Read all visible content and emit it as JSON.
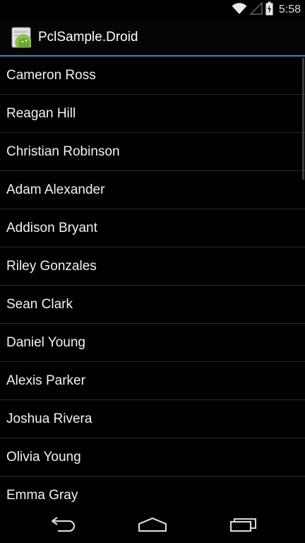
{
  "status_bar": {
    "time": "5:58",
    "icons": [
      "wifi-icon",
      "signal-icon",
      "battery-charging-icon"
    ]
  },
  "action_bar": {
    "title": "PclSample.Droid",
    "icon": "android-app-icon",
    "accent_color": "#33b5e5"
  },
  "list": {
    "items": [
      {
        "label": "Cameron Ross"
      },
      {
        "label": "Reagan Hill"
      },
      {
        "label": "Christian Robinson"
      },
      {
        "label": "Adam Alexander"
      },
      {
        "label": "Addison Bryant"
      },
      {
        "label": "Riley Gonzales"
      },
      {
        "label": "Sean Clark"
      },
      {
        "label": "Daniel Young"
      },
      {
        "label": "Alexis Parker"
      },
      {
        "label": "Joshua Rivera"
      },
      {
        "label": "Olivia Young"
      },
      {
        "label": "Emma Gray"
      }
    ]
  },
  "nav_bar": {
    "buttons": [
      "back-icon",
      "home-icon",
      "recent-apps-icon"
    ]
  }
}
